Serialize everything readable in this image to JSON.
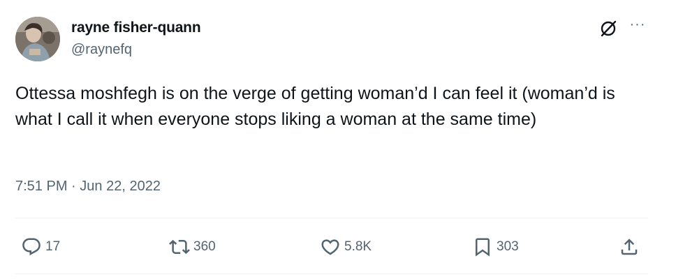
{
  "author": {
    "display_name": "rayne fisher-quann",
    "handle": "@raynefq",
    "avatar_icon": "profile-photo"
  },
  "tweet": {
    "text": "Ottessa moshfegh is on the verge of getting woman’d I can feel it (woman’d is what I call it when everyone stops liking a woman at the same time)",
    "time": "7:51 PM",
    "separator": "·",
    "date": "Jun 22, 2022"
  },
  "header_icons": {
    "grok": "grok-icon",
    "more": "more-icon"
  },
  "actions": {
    "replies": "17",
    "retweets": "360",
    "likes": "5.8K",
    "bookmarks": "303"
  },
  "colors": {
    "text_primary": "#0f1419",
    "text_secondary": "#536471",
    "divider": "#eff3f4"
  }
}
